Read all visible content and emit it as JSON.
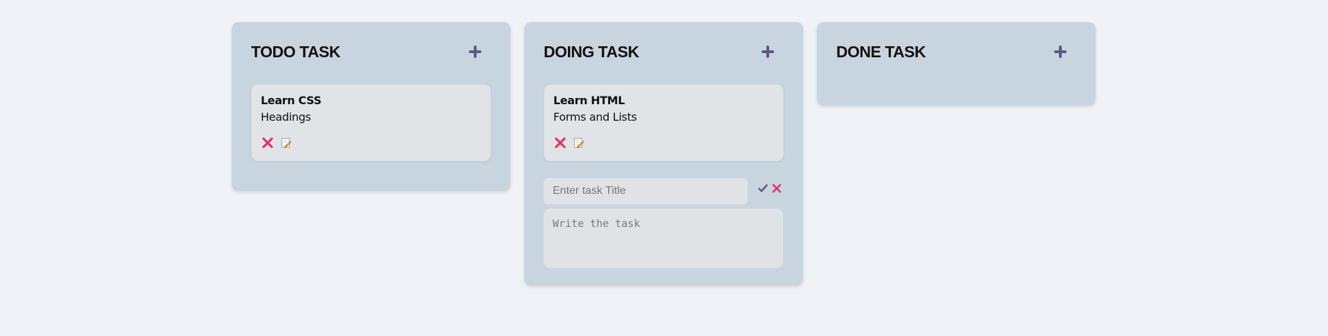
{
  "columns": [
    {
      "title": "TODO TASK",
      "cards": [
        {
          "title": "Learn CSS",
          "description": "Headings"
        }
      ]
    },
    {
      "title": "DOING TASK",
      "cards": [
        {
          "title": "Learn HTML",
          "description": "Forms and Lists"
        }
      ],
      "form": {
        "title_placeholder": "Enter task Title",
        "task_placeholder": "Write the task"
      }
    },
    {
      "title": "DONE TASK",
      "cards": []
    }
  ],
  "icons": {
    "add": "plus-icon",
    "delete": "close-icon",
    "edit": "edit-icon",
    "confirm": "check-icon",
    "cancel": "close-icon"
  },
  "colors": {
    "page_bg": "#eff3f7",
    "column_bg": "#c9d5de",
    "card_bg": "#e0e4e7",
    "accent": "#5b5688",
    "delete": "#e5305f"
  }
}
